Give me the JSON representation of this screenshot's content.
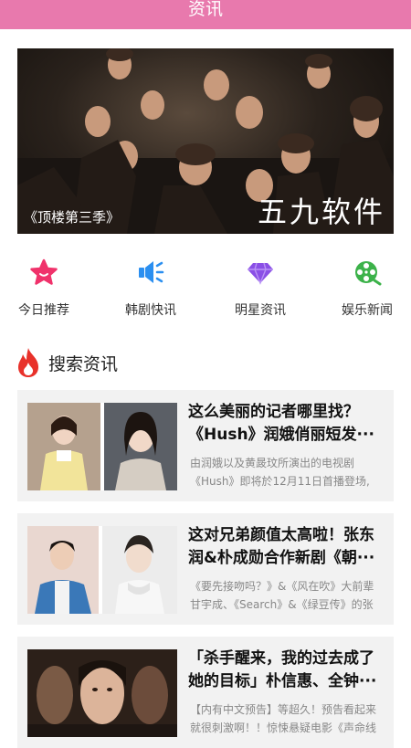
{
  "header": {
    "title": "资讯"
  },
  "banner": {
    "caption": "《顶楼第三季》",
    "brand": "五九软件"
  },
  "quick_nav": [
    {
      "label": "今日推荐",
      "icon": "star-icon",
      "color": "#f0326b"
    },
    {
      "label": "韩剧快讯",
      "icon": "speaker-icon",
      "color": "#2b8ff0"
    },
    {
      "label": "明星资讯",
      "icon": "diamond-icon",
      "color": "#8a4fe6"
    },
    {
      "label": "娱乐新闻",
      "icon": "film-reel-icon",
      "color": "#3cb24a"
    }
  ],
  "section": {
    "title": "搜索资讯",
    "icon": "fire-icon",
    "icon_color": "#e8312a"
  },
  "news": [
    {
      "title": "这么美丽的记者哪里找？《Hush》润娥俏丽短发···",
      "desc": "由润娥以及黄晸玟所演出的电视剧《Hush》即将於12月11日首播登场,"
    },
    {
      "title": "这对兄弟颜值太高啦！张东润&朴成勋合作新剧《朝···",
      "desc": "《要先接吻吗？》&《风在吹》大前辈甘宇成、《Search》&《绿豆传》的张"
    },
    {
      "title": "「杀手醒来，我的过去成了她的目标」朴信惠、全钟···",
      "desc": "【内有中文预告】等超久！预告看起来就很刺激啊！！惊悚悬疑电影《声命线"
    }
  ]
}
